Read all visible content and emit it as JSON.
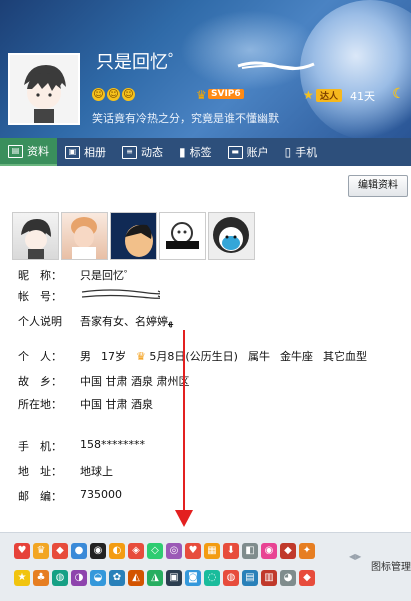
{
  "header": {
    "nickname": "只是回忆゜",
    "svip_label": "SVIP6",
    "daren_label": "达人",
    "days": "41天",
    "signature": "笑话竟有冷热之分，究竟是谁不懂幽默"
  },
  "tabs": [
    {
      "label": "资料",
      "icon": "id-card-icon"
    },
    {
      "label": "相册",
      "icon": "photo-album-icon"
    },
    {
      "label": "动态",
      "icon": "feed-icon"
    },
    {
      "label": "标签",
      "icon": "bookmark-icon"
    },
    {
      "label": "账户",
      "icon": "wallet-icon"
    },
    {
      "label": "手机",
      "icon": "phone-icon"
    }
  ],
  "edit_button": "编辑资料",
  "profile": {
    "nickname_label": "昵　称：",
    "nickname_value": "只是回忆゜",
    "account_label": "帐　号：",
    "bio_label": "个人说明",
    "bio_value": "吾家有女、名婷婷ﻬ",
    "personal_label": "个　人：",
    "gender": "男",
    "age": "17岁",
    "birthday": "5月8日(公历生日)",
    "zodiac_cn": "属牛",
    "zodiac": "金牛座",
    "blood": "其它血型",
    "hometown_label": "故　乡：",
    "hometown_value": "中国 甘肃 酒泉 肃州区",
    "location_label": "所在地：",
    "location_value": "中国 甘肃 酒泉",
    "mobile_label": "手　机：",
    "mobile_value": "158********",
    "address_label": "地　址：",
    "address_value": "地球上",
    "postcode_label": "邮　编：",
    "postcode_value": "735000"
  },
  "icon_manager": "图标管理"
}
